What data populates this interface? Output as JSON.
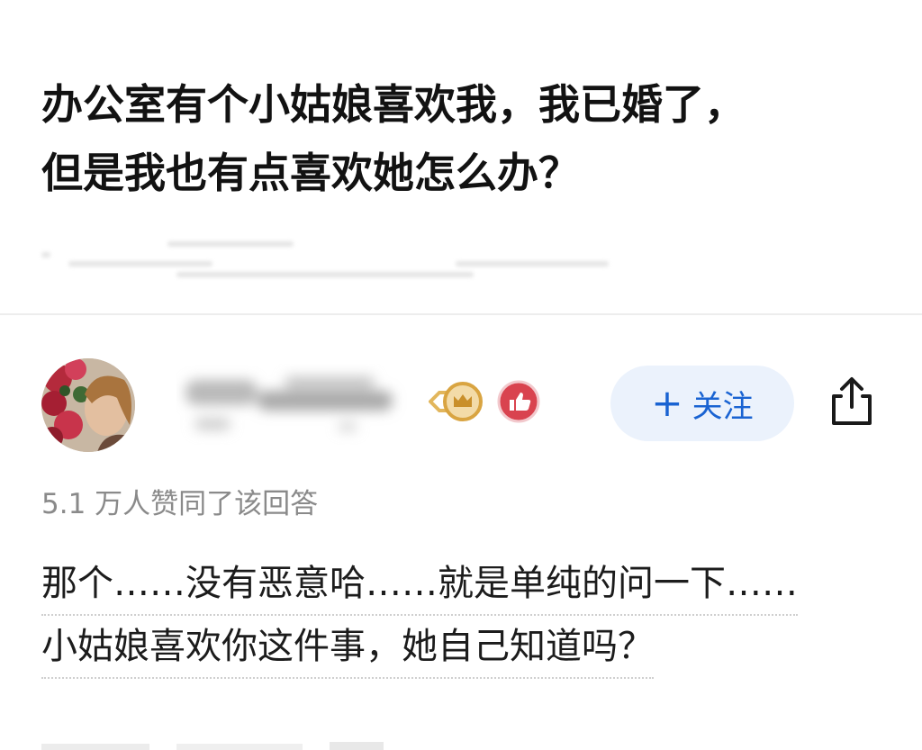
{
  "question": {
    "title_line1": "办公室有个小姑娘喜欢我，我已婚了，",
    "title_line2": "但是我也有点喜欢她怎么办？"
  },
  "answer": {
    "author_name": "",
    "follow_label": "关注",
    "follow_plus": "+",
    "upvote_text": "5.1 万人赞同了该回答",
    "body_line1": "那个……没有恶意哈……就是单纯的问一下……",
    "body_line2": "小姑娘喜欢你这件事，她自己知道吗？"
  },
  "icons": {
    "share": "share-icon",
    "crown_badge": "crown-badge-icon",
    "like_badge": "like-badge-icon"
  },
  "colors": {
    "follow_bg": "#ebf2fc",
    "follow_text": "#1963d2",
    "badge_gold": "#d9a441",
    "badge_red": "#d9434f",
    "muted_text": "#8a8a8a"
  }
}
